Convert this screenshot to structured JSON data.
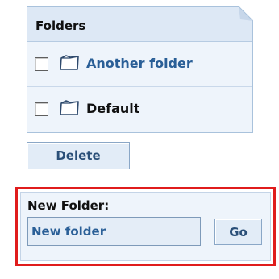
{
  "folders_panel": {
    "title": "Folders",
    "rows": [
      {
        "label": "Another folder",
        "checked": false,
        "is_link": true,
        "icon": "folder-icon"
      },
      {
        "label": "Default",
        "checked": false,
        "is_link": false,
        "icon": "folder-icon"
      }
    ]
  },
  "actions": {
    "delete_label": "Delete"
  },
  "new_folder": {
    "label": "New Folder:",
    "input_value": "New folder",
    "go_label": "Go"
  },
  "colors": {
    "accent": "#2a5f97",
    "highlight_border": "#e01c1c",
    "panel_bg": "#eef4fb",
    "header_bg": "#dde8f5"
  }
}
